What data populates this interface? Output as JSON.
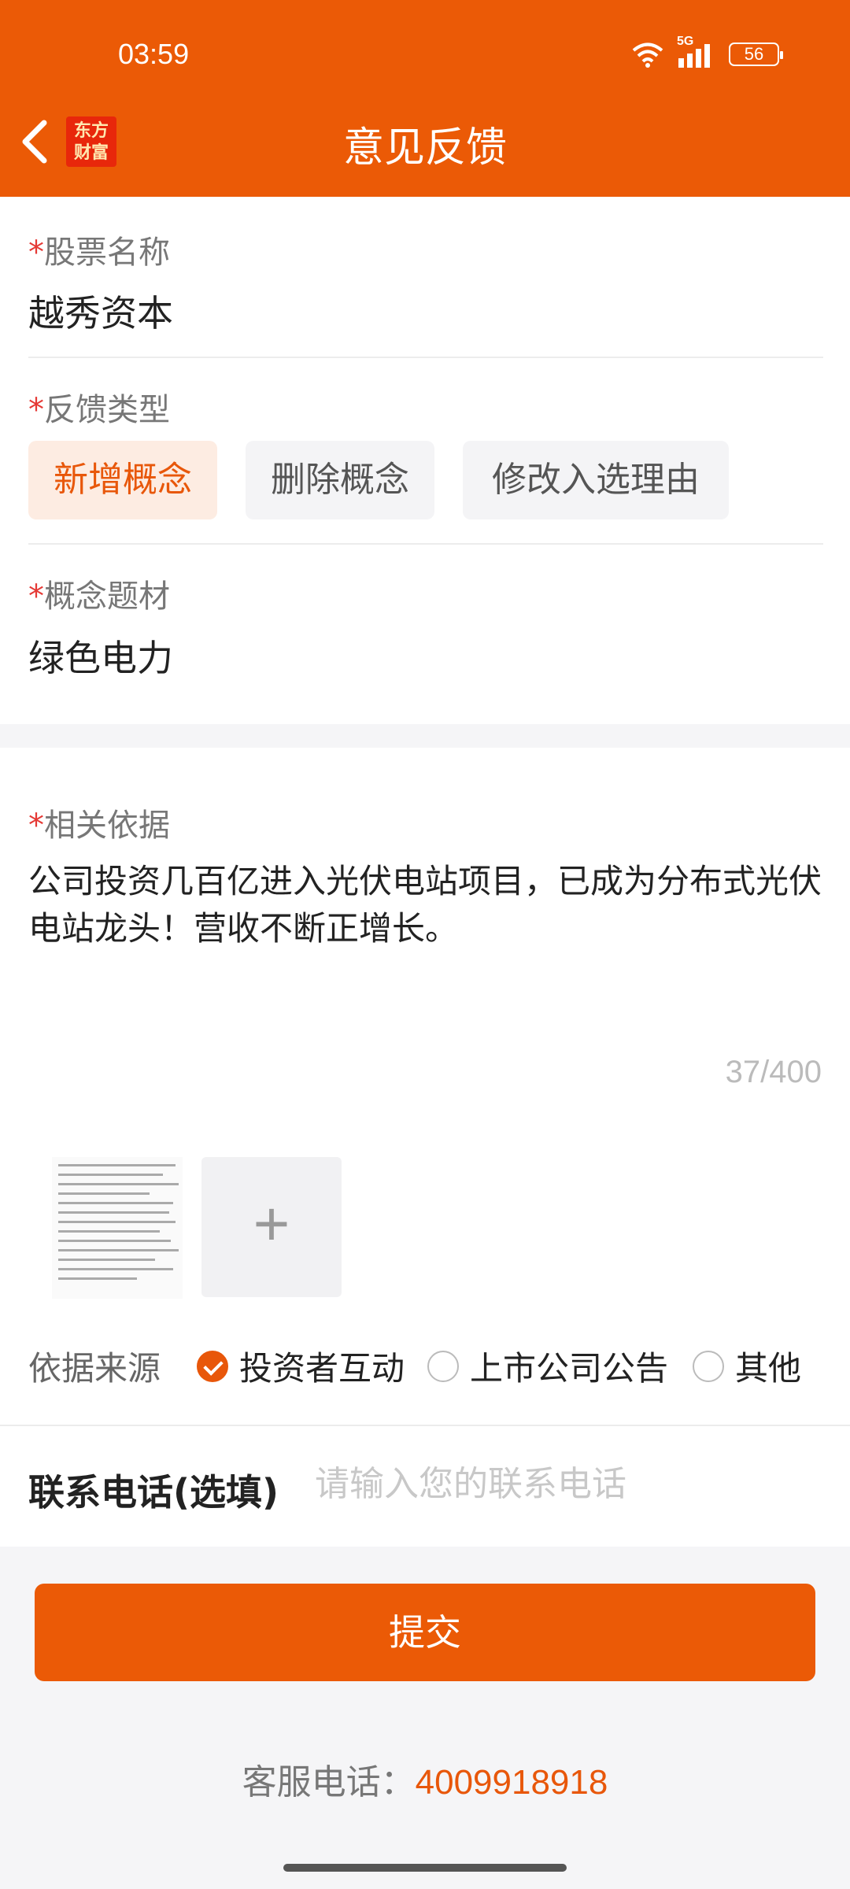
{
  "status": {
    "time": "03:59",
    "network": "5G",
    "battery": "56"
  },
  "header": {
    "title": "意见反馈",
    "logo_line1": "东方",
    "logo_line2": "财富"
  },
  "form": {
    "stock_label": "股票名称",
    "stock_value": "越秀资本",
    "type_label": "反馈类型",
    "types": [
      "新增概念",
      "删除概念",
      "修改入选理由"
    ],
    "concept_label": "概念题材",
    "concept_value": "绿色电力",
    "basis_label": "相关依据",
    "basis_text": "公司投资几百亿进入光伏电站项目，已成为分布式光伏电站龙头！营收不断正增长。",
    "char_count": "37/400",
    "source_label": "依据来源",
    "sources": [
      "投资者互动",
      "上市公司公告",
      "其他"
    ],
    "selected_source": "投资者互动",
    "phone_label": "联系电话(选填)",
    "phone_placeholder": "请输入您的联系电话",
    "required_mark": "*"
  },
  "actions": {
    "submit_label": "提交",
    "add_icon": "+"
  },
  "footer": {
    "service_label": "客服电话：",
    "service_number": "4009918918"
  },
  "colors": {
    "accent": "#eb5a06",
    "chip_active_bg": "#fdece2",
    "required": "#e53935"
  }
}
